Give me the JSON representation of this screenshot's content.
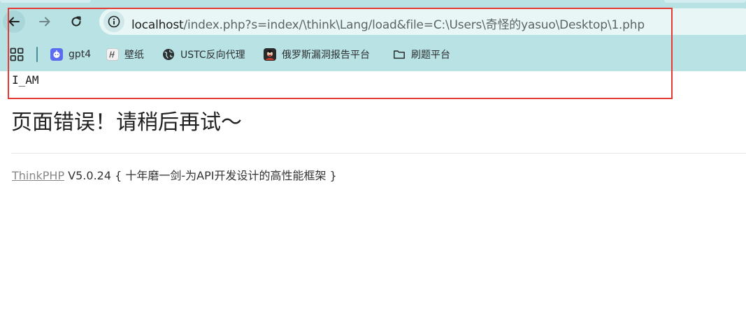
{
  "browser": {
    "address_bar": {
      "host": "localhost",
      "path": "/index.php?s=index/\\think\\Lang/load&file=C:\\Users\\奇怪的yasuo\\Desktop\\1.php"
    },
    "bookmarks": [
      {
        "label": "gpt4",
        "icon": "gpt-robot-icon"
      },
      {
        "label": "壁纸",
        "icon": "wallpaper-icon"
      },
      {
        "label": "USTC反向代理",
        "icon": "globe-icon"
      },
      {
        "label": "俄罗斯漏洞报告平台",
        "icon": "avatar-icon"
      },
      {
        "label": "刷题平台",
        "icon": "folder-icon"
      }
    ]
  },
  "page": {
    "echo_output": "I_AM",
    "error_title": "页面错误！请稍后再试～",
    "framework_link": "ThinkPHP",
    "framework_version": " V5.0.24 ",
    "slogan": "{ 十年磨一剑-为API开发设计的高性能框架 }"
  },
  "colors": {
    "chrome_bg": "#b9e2e4",
    "omnibox_bg": "#e9f6f6",
    "annotation": "#e53935"
  }
}
